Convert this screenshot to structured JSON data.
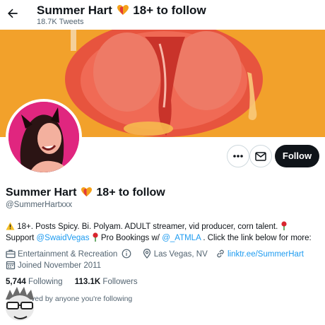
{
  "header": {
    "name": "Summer Hart",
    "name_suffix": "18+ to follow",
    "tweets": "18.7K Tweets"
  },
  "actions": {
    "follow_label": "Follow",
    "more_icon": "more-icon",
    "message_icon": "message-icon"
  },
  "profile": {
    "name": "Summer Hart",
    "name_suffix": "18+ to follow",
    "handle": "@SummerHartxxx"
  },
  "bio": {
    "line1": "18+. Posts Spicy. Bi. Polyam. ADULT streamer, vid producer, corn talent.",
    "line2_a": "Support",
    "mention1": "@SwaidVegas",
    "line2_b": "Pro Bookings w/",
    "mention2": "@_ATMLA",
    "line2_c": ". Click the link below for more:"
  },
  "meta": {
    "category": "Entertainment & Recreation",
    "location": "Las Vegas, NV",
    "website": "linktr.ee/SummerHart",
    "joined": "Joined November 2011"
  },
  "stats": {
    "following_count": "5,744",
    "following_label": "Following",
    "followers_count": "113.1K",
    "followers_label": "Followers"
  },
  "followed_note": "ved by anyone you're following",
  "colors": {
    "accent": "#1d9bf0",
    "text": "#0f1419",
    "muted": "#536471",
    "banner": "#f2a12b",
    "avatar_bg": "#e0267f"
  }
}
